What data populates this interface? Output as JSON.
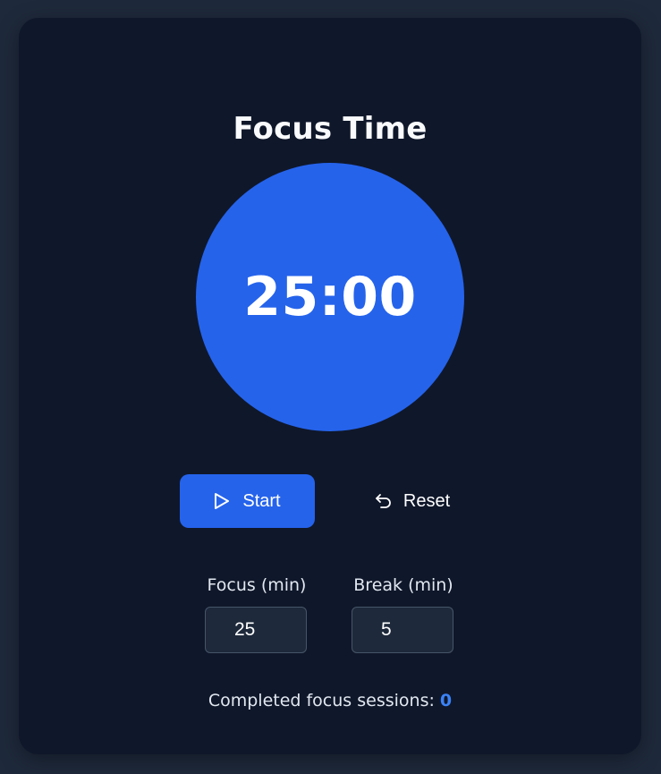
{
  "app": {
    "title": "Focus Time",
    "timer_display": "25:00"
  },
  "controls": {
    "start_label": "Start",
    "start_icon": "play-icon",
    "reset_label": "Reset",
    "reset_icon": "undo-icon"
  },
  "settings": {
    "focus_label": "Focus (min)",
    "focus_value": "25",
    "break_label": "Break (min)",
    "break_value": "5"
  },
  "stats": {
    "sessions_label": "Completed focus sessions:",
    "sessions_count": "0"
  },
  "colors": {
    "background": "#1e293b",
    "card": "#0f172a",
    "accent": "#2563eb",
    "count_accent": "#3b82f6"
  }
}
